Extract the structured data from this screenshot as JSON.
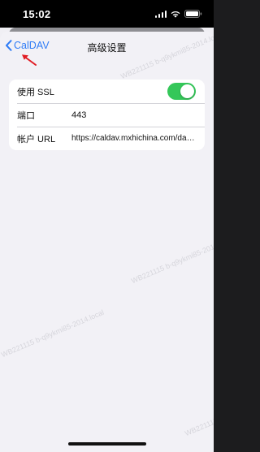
{
  "status_bar": {
    "time": "15:02"
  },
  "nav": {
    "back_label": "CalDAV",
    "title": "高级设置"
  },
  "settings": {
    "rows": [
      {
        "label": "使用 SSL",
        "toggle_on": true
      },
      {
        "label": "端口",
        "value": "443"
      },
      {
        "label": "帐户 URL",
        "value": "https://caldav.mxhichina.com/dav..."
      }
    ]
  },
  "watermark": {
    "text": "WB221115 b-q9ykmi85-2014.local"
  },
  "colors": {
    "accent": "#2f7cf6",
    "toggle_on": "#34c759",
    "annotation_arrow": "#e11d24"
  }
}
